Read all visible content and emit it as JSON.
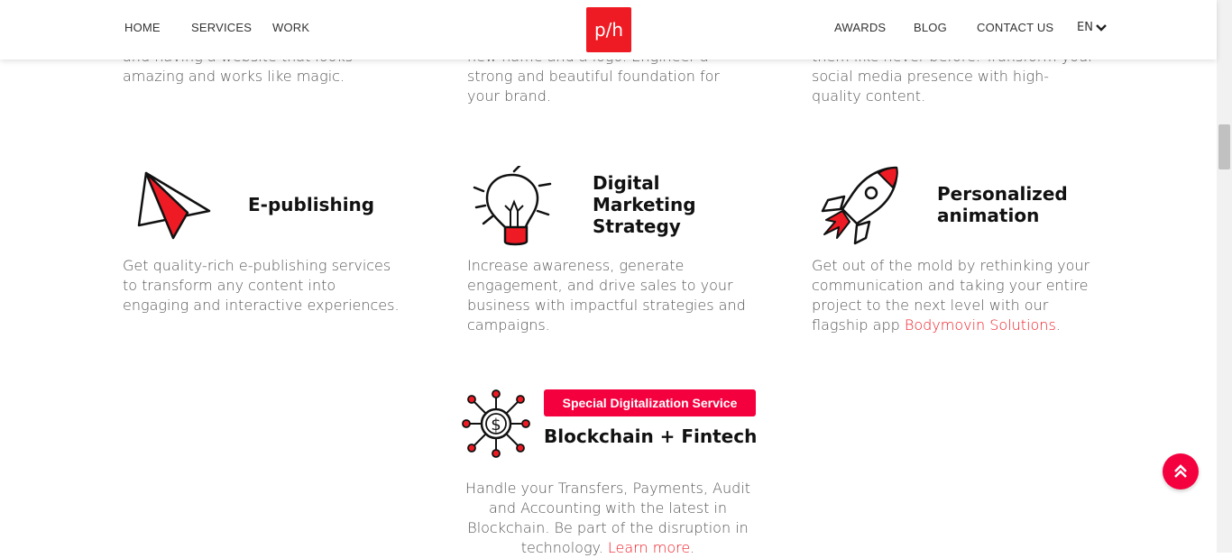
{
  "nav": {
    "home": "HOME",
    "services": "SERVICES",
    "work": "WORK",
    "awards": "AWARDS",
    "blog": "BLOG",
    "contact": "CONTACT US",
    "lang": "EN",
    "logo": "p/h"
  },
  "top_partial": {
    "col1_line1": "and having a website that looks",
    "col1_line2": "amazing and works like magic.",
    "col2_line1": "new name and a logo. Engineer a",
    "col2_line2": "strong and beautiful foundation for",
    "col2_line3": "your brand.",
    "col3_line1": "them like never before. Transform your",
    "col3_line2": "social media presence with high-",
    "col3_line3": "quality content."
  },
  "services": {
    "epublishing": {
      "title": "E-publishing",
      "lines": [
        "Get quality-rich e-publishing services",
        "to transform any content into",
        "engaging and interactive experiences."
      ]
    },
    "marketing": {
      "title_lines": [
        "Digital",
        "Marketing",
        "Strategy"
      ],
      "lines": [
        "Increase awareness, generate",
        "engagement, and drive sales to your",
        "business with impactful strategies and",
        "campaigns."
      ]
    },
    "animation": {
      "title_lines": [
        "Personalized",
        "animation"
      ],
      "lines": [
        "Get out of the mold by rethinking your",
        "communication and taking your entire",
        "project to the next level with our"
      ],
      "last_prefix": "flagship app ",
      "link": "Bodymovin Solutions",
      "last_suffix": "."
    },
    "blockchain": {
      "badge": "Special Digitalization Service",
      "title": "Blockchain + Fintech",
      "lines": [
        "Handle your Transfers, Payments, Audit",
        "and Accounting with the latest in",
        "Blockchain. Be part of the disruption in"
      ],
      "last_prefix": "technology. ",
      "link": "Learn more",
      "last_suffix": "."
    }
  },
  "colors": {
    "accent": "#ef1b24",
    "badge": "#f5003f"
  }
}
